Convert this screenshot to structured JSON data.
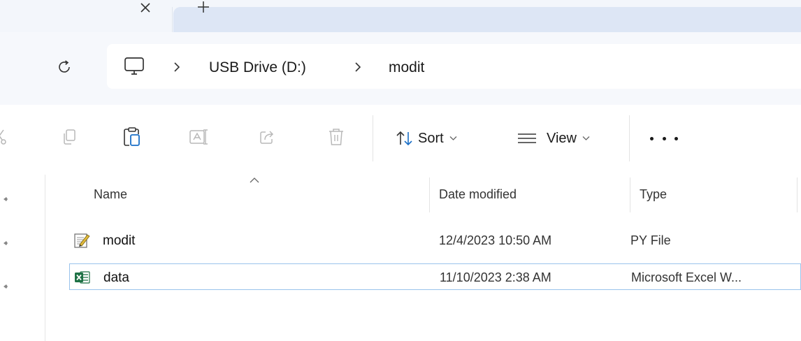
{
  "tabstrip": {
    "close_icon": "close-icon",
    "new_tab_icon": "plus-icon"
  },
  "address_bar": {
    "refresh_icon": "refresh-icon",
    "computer_icon": "monitor-icon",
    "breadcrumb": [
      {
        "label": "USB Drive (D:)"
      },
      {
        "label": "modit"
      }
    ],
    "separator_icon": "chevron-right-icon"
  },
  "command_bar": {
    "icons": [
      "copy-icon",
      "paste-icon",
      "rename-icon",
      "share-icon",
      "delete-icon"
    ],
    "sort_label": "Sort",
    "view_label": "View",
    "more_icon": "ellipsis-icon"
  },
  "file_list": {
    "columns": [
      {
        "label": "Name"
      },
      {
        "label": "Date modified"
      },
      {
        "label": "Type"
      }
    ],
    "sorted_column": "Name",
    "rows": [
      {
        "name": "modit",
        "date": "12/4/2023 10:50 AM",
        "type": "PY File",
        "icon": "python-file-icon",
        "selected": false
      },
      {
        "name": "data",
        "date": "11/10/2023 2:38 AM",
        "type": "Microsoft Excel W...",
        "icon": "excel-file-icon",
        "selected": true
      }
    ]
  },
  "colors": {
    "tab_strip_bg": "#f3f6fb",
    "active_tab_bg": "#dde6f5",
    "selection_border": "#99c3ec",
    "excel_green": "#1e7145"
  }
}
